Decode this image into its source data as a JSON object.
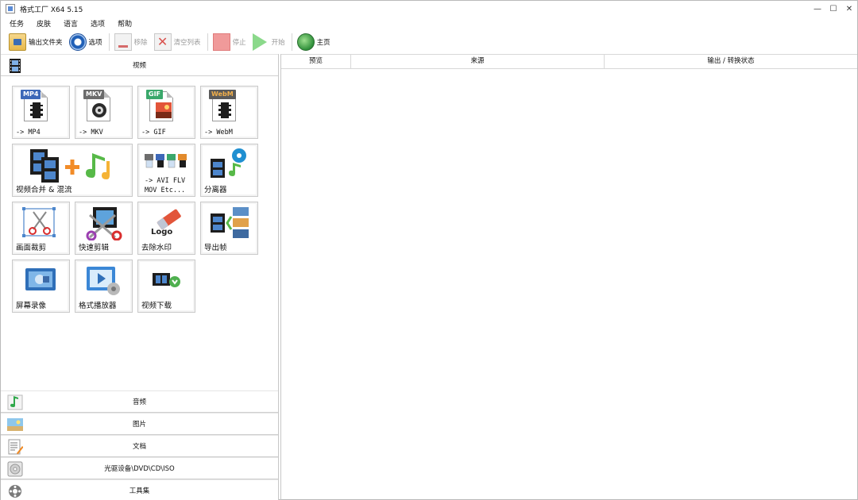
{
  "window": {
    "title": "格式工厂 X64 5.15",
    "controls": {
      "minimize": "—",
      "maximize": "☐",
      "close": "✕"
    }
  },
  "menu": [
    "任务",
    "皮肤",
    "语言",
    "选项",
    "帮助"
  ],
  "toolbar": {
    "output_folder": "输出文件夹",
    "options": "选项",
    "remove": "移除",
    "clear_list": "清空列表",
    "stop": "停止",
    "start": "开始",
    "home": "主页"
  },
  "left": {
    "video_header": "视频",
    "tiles": {
      "mp4": {
        "badge": "MP4",
        "label": "-> MP4",
        "badge_color": "#3d68b8"
      },
      "mkv": {
        "badge": "MKV",
        "label": "-> MKV",
        "badge_color": "#6b6b6b"
      },
      "gif": {
        "badge": "GIF",
        "label": "-> GIF",
        "badge_color": "#3aa86b"
      },
      "webm": {
        "badge": "WebM",
        "label": "-> WebM",
        "badge_color": "#5a5a5a"
      },
      "merge": {
        "label": "视频合并 & 混流"
      },
      "avi_flv": {
        "line1": "-> AVI FLV",
        "line2": "MOV Etc..."
      },
      "splitter": {
        "label": "分离器"
      },
      "crop": {
        "label": "画面裁剪"
      },
      "quick_clip": {
        "label": "快速剪辑"
      },
      "watermark": {
        "label": "去除水印",
        "logo_text": "Logo"
      },
      "export_frames": {
        "label": "导出帧"
      },
      "screen_record": {
        "label": "屏幕录像"
      },
      "player": {
        "label": "格式播放器"
      },
      "video_download": {
        "label": "视频下载"
      }
    },
    "categories": [
      "音频",
      "图片",
      "文档",
      "光驱设备\\DVD\\CD\\ISO",
      "工具集"
    ]
  },
  "right": {
    "columns": [
      "预览",
      "来源",
      "输出 / 转换状态"
    ]
  },
  "icons": {
    "output_folder": "folder-icon",
    "options": "gear-icon",
    "remove": "remove-icon",
    "clear": "clear-list-icon",
    "stop": "stop-icon",
    "start": "play-icon",
    "home": "globe-icon"
  }
}
